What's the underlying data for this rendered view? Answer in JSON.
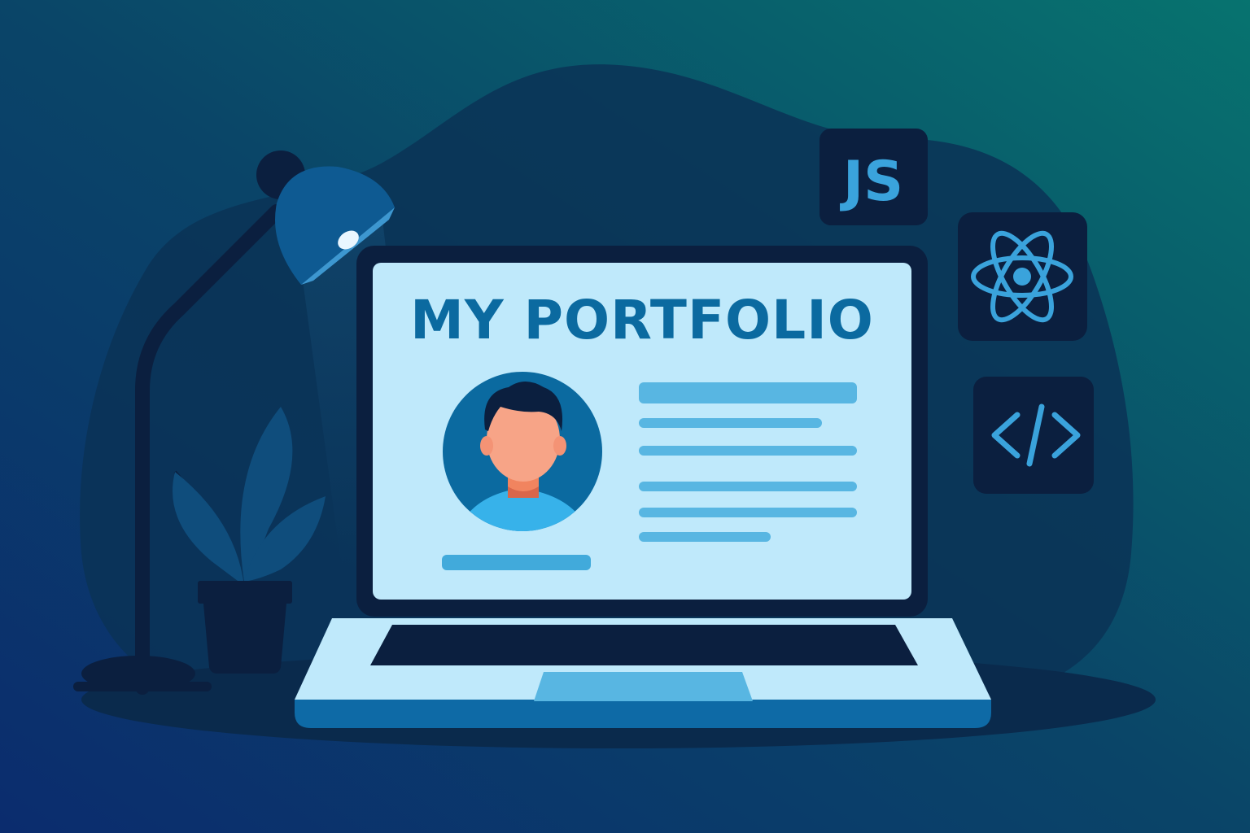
{
  "screen": {
    "title": "MY PORTFOLIO"
  },
  "badges": [
    {
      "icon": "js-icon",
      "label": "JS"
    },
    {
      "icon": "react-icon",
      "label": ""
    },
    {
      "icon": "code-brackets-icon",
      "label": ""
    }
  ],
  "colors": {
    "background_start": "#0b2c6e",
    "background_end": "#07736f",
    "blob": "#0a3356",
    "screen": "#bfe9fb",
    "title": "#0b6aa0",
    "accent": "#58b6e2",
    "dark": "#0b1f3f"
  }
}
